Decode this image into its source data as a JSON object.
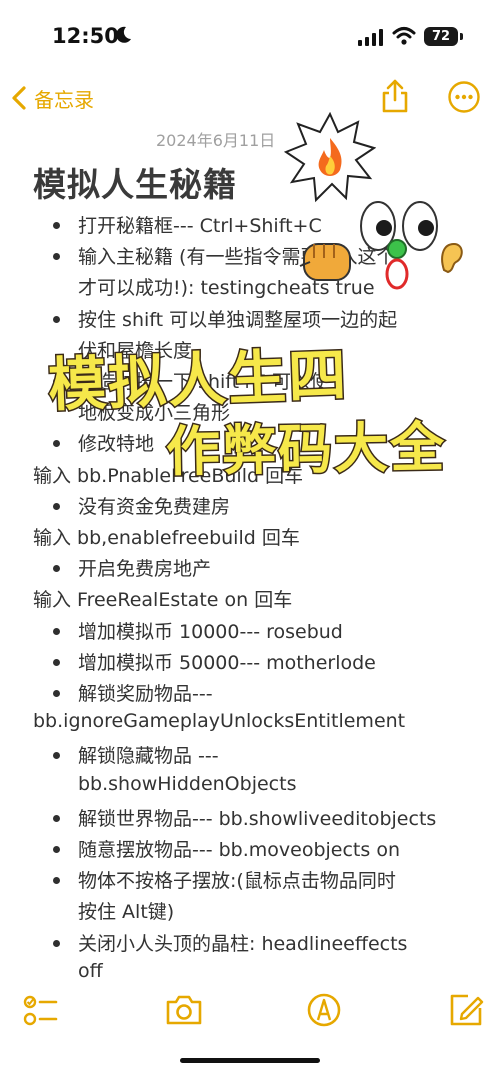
{
  "status_bar": {
    "time": "12:50",
    "battery": "72"
  },
  "nav": {
    "back_label": "备忘录"
  },
  "note": {
    "date": "2024年6月11日",
    "title": "模拟人生秘籍",
    "lines": [
      {
        "text": "打开秘籍框--- Ctrl+Shift+C",
        "bullet": true
      },
      {
        "text": "输入主秘籍 (有一些指令需要输入这个",
        "bullet": true
      },
      {
        "text": "才可以成功!):   testingcheats true",
        "bullet": false,
        "indent": true
      },
      {
        "text": " 按住 shift 可以单独调整屋项一边的起",
        "bullet": true
      },
      {
        "text": "伏和屋檐长度",
        "bullet": false,
        "indent": true
      },
      {
        "text": "建造时按一下 shift+F 可以使",
        "bullet": true
      },
      {
        "text": "地板变成小三角形",
        "bullet": false,
        "indent": true
      },
      {
        "text": "修改特地",
        "bullet": true
      },
      {
        "text": "输入 bb.PnableFreeBuild 回车",
        "bullet": false,
        "indent": false
      },
      {
        "text": "没有资金免费建房",
        "bullet": true
      },
      {
        "text": "输入 bb,enablefreebuild 回车",
        "bullet": false,
        "indent": false
      },
      {
        "text": "开启免费房地产",
        "bullet": true
      },
      {
        "text": "输入 FreeRealEstate on 回车",
        "bullet": false,
        "indent": false
      },
      {
        "text": "增加模拟币 10000--- rosebud",
        "bullet": true
      },
      {
        "text": "增加模拟币 50000--- motherlode",
        "bullet": true
      },
      {
        "text": "解锁奖励物品---",
        "bullet": true
      },
      {
        "text": "bb.ignoreGameplayUnlocksEntitlement",
        "bullet": false,
        "indent": false
      },
      {
        "text": "解锁隐藏物品 ---",
        "bullet": true
      },
      {
        "text": "bb.showHiddenObjects",
        "bullet": false,
        "indent": true
      },
      {
        "text": "解锁世界物品--- bb.showliveeditobjects",
        "bullet": true
      },
      {
        "text": "随意摆放物品--- bb.moveobjects on",
        "bullet": true
      },
      {
        "text": "物体不按格子摆放:(鼠标点击物品同时",
        "bullet": true
      },
      {
        "text": "按住 Alt键)",
        "bullet": false,
        "indent": true
      },
      {
        "text": "关闭小人头顶的晶柱: headlineeffects",
        "bullet": true
      },
      {
        "text": "off",
        "bullet": false,
        "indent": true
      }
    ]
  },
  "overlay": {
    "banner_line1": "模拟人生四",
    "banner_line2": "作弊码大全",
    "stickers": [
      "fire-emoji",
      "eyes-emoji",
      "fist-emoji",
      "ear-emoji",
      "green-pin",
      "red-ring"
    ]
  },
  "toolbar": {
    "items": [
      "checklist-icon",
      "camera-icon",
      "markup-icon",
      "compose-icon"
    ]
  },
  "colors": {
    "accent": "#e6a800",
    "banner_fill": "#f6e84a",
    "banner_stroke": "#3a2a18"
  }
}
